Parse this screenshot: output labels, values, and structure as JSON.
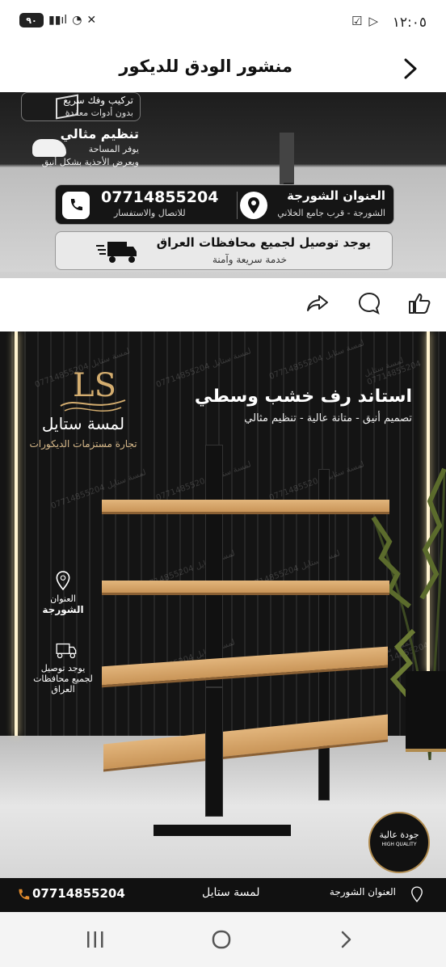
{
  "status_bar": {
    "time": "١٢:٠٥",
    "battery": "٩٠"
  },
  "header": {
    "title": "منشور الودق للديكور"
  },
  "post_image_1": {
    "assembly_title": "تركيب وفك سريع",
    "assembly_sub": "بدون أدوات معقدة",
    "organize_title": "تنظيم مثالي",
    "organize_sub1": "يوفر المساحة",
    "organize_sub2": "ويعرض الأحذية بشكل أنيق",
    "phone": "07714855204",
    "phone_sub": "للاتصال والاستفسار",
    "address_title": "العنوان الشورجة",
    "address_sub": "الشورجة - قرب جامع الخلاني",
    "delivery_title": "يوجد توصيل لجميع محافظات العراق",
    "delivery_sub": "خدمة سريعة وآمنة"
  },
  "post_image_2": {
    "brand_logo": "LS",
    "brand_name": "لمسة ستايل",
    "brand_sub": "تجارة مستزمات الديكورات",
    "title": "استاند رف خشب وسطي",
    "subtitle": "تصميم أنيق - متانة عالية - تنظيم مثالي",
    "address_label": "العنوان",
    "address_value": "الشورجة",
    "delivery_label": "يوجد توصيل",
    "delivery_value": "لجميع محافظات العراق",
    "seal_ar": "جودة عالية",
    "seal_en": "HIGH QUALITY",
    "watermark": "لمسة ستايل 07714855204",
    "bottom_phone": "07714855204",
    "bottom_brand": "لمسة ستايل",
    "bottom_address": "العنوان الشورجة"
  },
  "icons": {
    "back": "chevron-right-icon",
    "share": "share-icon",
    "comment": "comment-icon",
    "like": "like-icon"
  },
  "colors": {
    "accent_gold": "#b08b4e",
    "wood": "#d9a867",
    "dark": "#111111"
  }
}
